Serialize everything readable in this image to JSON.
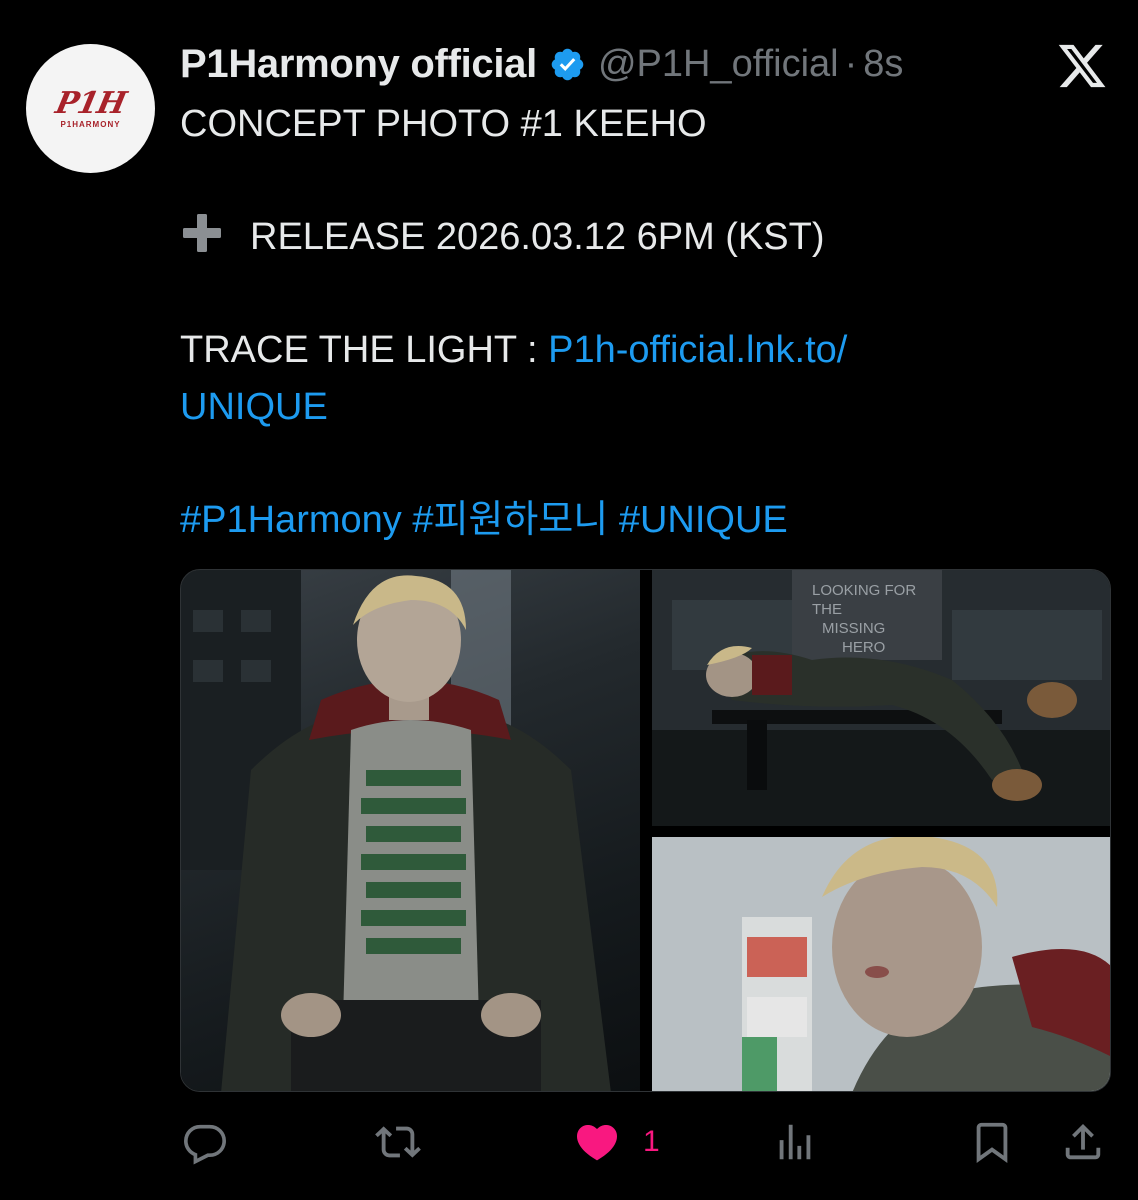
{
  "account": {
    "display_name": "P1Harmony official",
    "handle": "@P1H_official",
    "separator": "·",
    "time": "8s",
    "avatar_logo_text": "P1H",
    "avatar_logo_subtext": "P1HARMONY",
    "verified_icon": "verified-badge-icon",
    "verified_color": "#1d9bf0"
  },
  "platform_icon": "x-logo-icon",
  "tweet": {
    "line1": "CONCEPT PHOTO #1 KEEHO",
    "release_icon": "heavy-plus-icon",
    "release_text": "RELEASE 2026.03.12 6PM (KST)",
    "trace_label": "TRACE THE LIGHT : ",
    "link_part1": "P1h-official.lnk.to/",
    "link_part2": "UNIQUE",
    "hashtags": [
      "#P1Harmony",
      "#피원하모니",
      "#UNIQUE"
    ]
  },
  "media": {
    "photos": [
      {
        "name": "photo-standing-portrait",
        "sign_text": ""
      },
      {
        "name": "photo-bench",
        "sign_text": "LOOKING FOR THE MISSING HERO"
      },
      {
        "name": "photo-closeup",
        "sign_text": ""
      }
    ]
  },
  "actions": {
    "reply_icon": "reply-icon",
    "repost_icon": "repost-icon",
    "like_icon": "heart-filled-icon",
    "like_count": "1",
    "views_icon": "views-icon",
    "bookmark_icon": "bookmark-icon",
    "share_icon": "share-icon"
  },
  "colors": {
    "background": "#000000",
    "text": "#e7e9ea",
    "muted": "#71767b",
    "link": "#1d9bf0",
    "like": "#f91880",
    "brand_red": "#a8222a"
  }
}
